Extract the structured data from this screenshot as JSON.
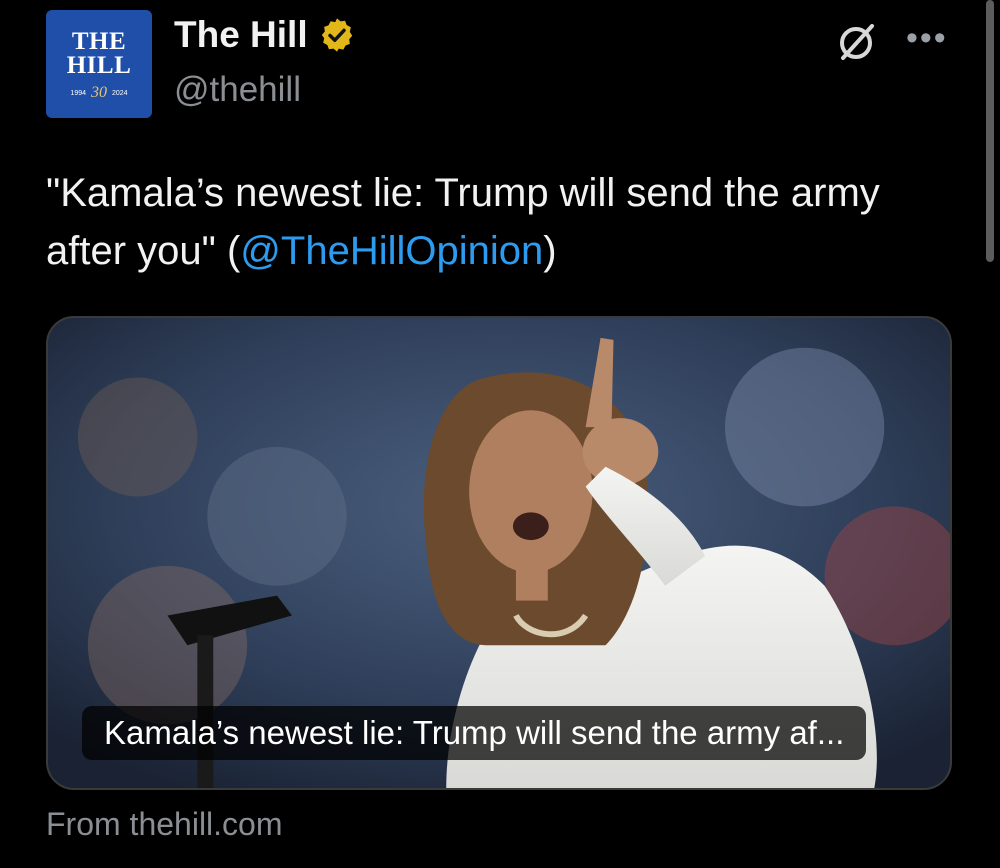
{
  "account": {
    "display_name": "The Hill",
    "handle": "@thehill",
    "avatar": {
      "line1": "THE",
      "line2": "HILL",
      "year_start": "1994",
      "anniversary": "30",
      "year_end": "2024"
    }
  },
  "tweet": {
    "text_prefix": "\"Kamala’s newest lie: Trump will send the army after you\" (",
    "mention": "@TheHillOpinion",
    "text_suffix": ")"
  },
  "card": {
    "caption": "Kamala’s newest lie: Trump will send the army af...",
    "source": "From thehill.com"
  },
  "icons": {
    "verified": "verified-badge-icon",
    "grok": "grok-icon",
    "more": "more-options-icon"
  },
  "colors": {
    "background": "#000000",
    "link": "#2d9cf0",
    "verified_gold": "#e2b719",
    "avatar_blue": "#1f4fa8"
  }
}
